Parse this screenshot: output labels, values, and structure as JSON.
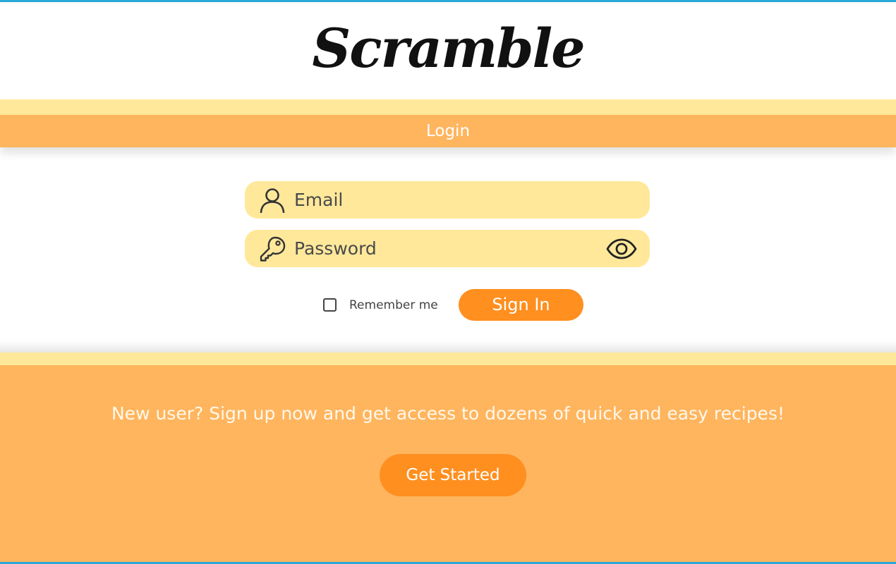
{
  "header": {
    "logo_text": "Scramble",
    "title": "Login"
  },
  "form": {
    "email": {
      "placeholder": "Email",
      "value": "",
      "icon": "user-icon"
    },
    "password": {
      "placeholder": "Password",
      "value": "",
      "icon": "key-icon",
      "toggle_icon": "eye-icon"
    },
    "remember_me": {
      "label": "Remember me",
      "checked": false
    },
    "sign_in_label": "Sign In"
  },
  "signup": {
    "promo_text": "New user? Sign up now and get access to dozens of quick and easy recipes!",
    "button_label": "Get Started"
  },
  "colors": {
    "accent_orange": "#ff8f1f",
    "band_orange": "#ffb55e",
    "band_yellow": "#ffe89a",
    "frame_blue": "#2aa8d8"
  }
}
